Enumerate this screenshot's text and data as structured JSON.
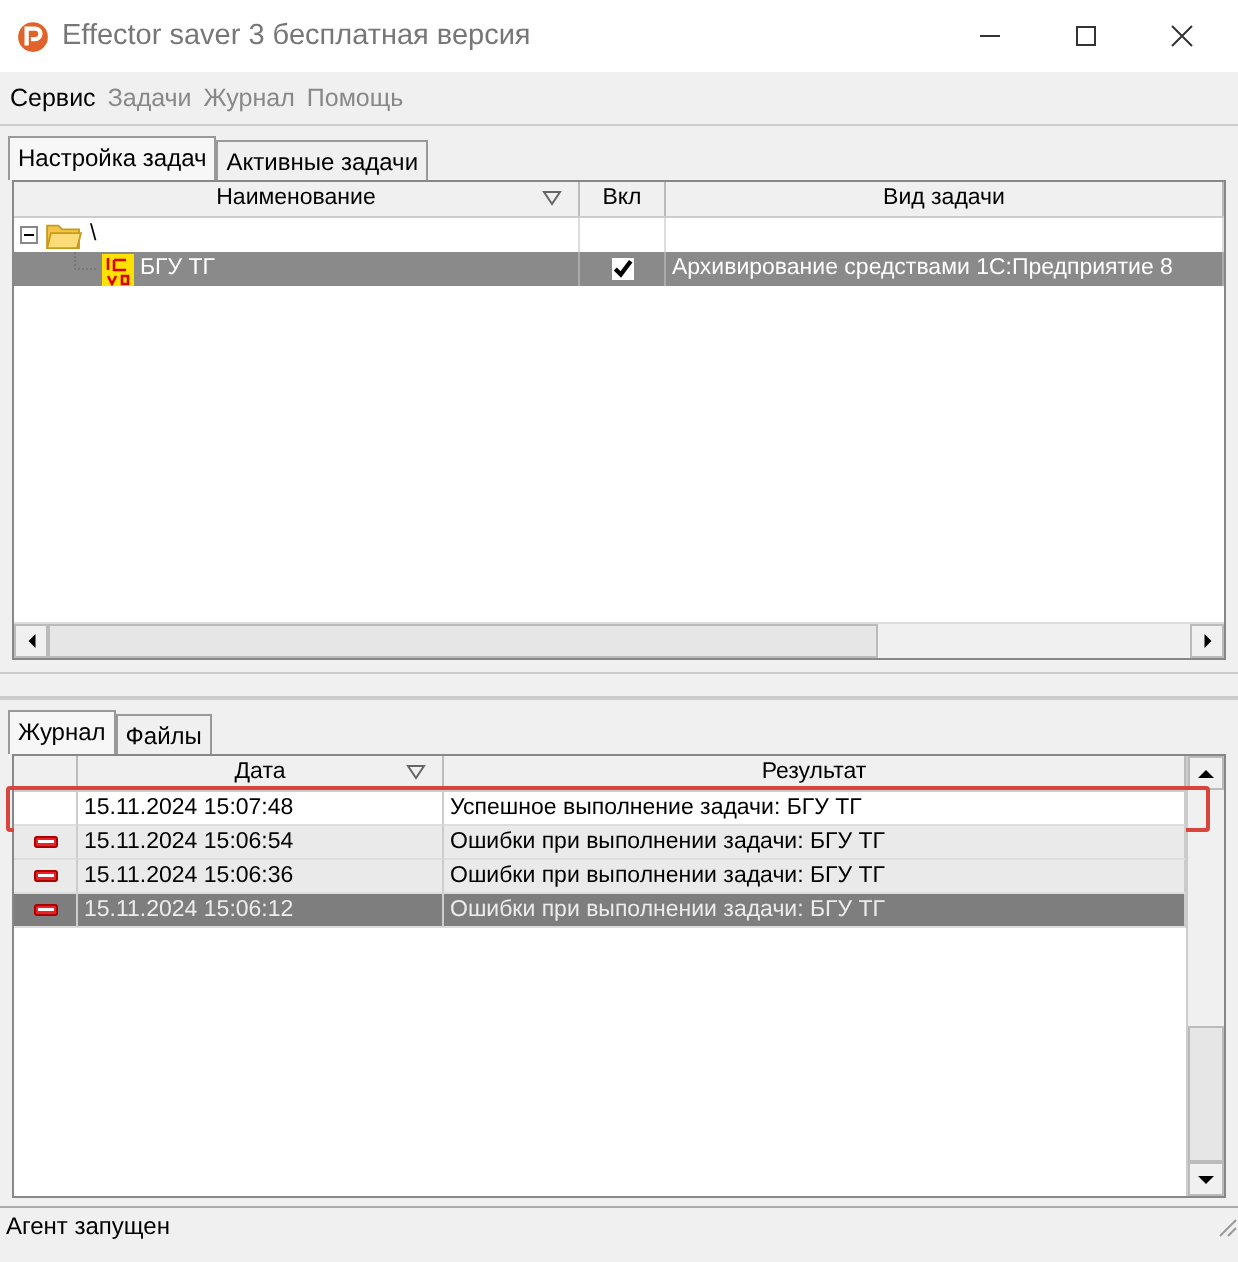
{
  "window": {
    "title": "Effector saver 3 бесплатная версия"
  },
  "menu": [
    {
      "label": "Сервис",
      "disabled": false
    },
    {
      "label": "Задачи",
      "disabled": true
    },
    {
      "label": "Журнал",
      "disabled": true
    },
    {
      "label": "Помощь",
      "disabled": true
    }
  ],
  "task_tabs": [
    {
      "label": "Настройка задач",
      "selected": true
    },
    {
      "label": "Активные задачи",
      "selected": false
    }
  ],
  "task_table": {
    "columns": [
      "Наименование",
      "Вкл",
      "Вид задачи"
    ],
    "tree": [
      {
        "name": "\\",
        "expanded": true,
        "children": [
          {
            "name": "БГУ ТГ",
            "enabled": true,
            "task_type": "Архивирование средствами 1С:Предприятие 8",
            "selected": true
          }
        ]
      }
    ]
  },
  "log_tabs": [
    {
      "label": "Журнал",
      "selected": true
    },
    {
      "label": "Файлы",
      "selected": false
    }
  ],
  "log_table": {
    "columns": [
      "Дата",
      "Результат"
    ],
    "rows": [
      {
        "kind": "success",
        "date": "15.11.2024 15:07:48",
        "result": "Успешное выполнение задачи: БГУ ТГ",
        "selected": false,
        "highlighted": true
      },
      {
        "kind": "error",
        "date": "15.11.2024 15:06:54",
        "result": "Ошибки при выполнении задачи: БГУ ТГ",
        "selected": false,
        "highlighted": false
      },
      {
        "kind": "error",
        "date": "15.11.2024 15:06:36",
        "result": "Ошибки при выполнении задачи: БГУ ТГ",
        "selected": false,
        "highlighted": false
      },
      {
        "kind": "error",
        "date": "15.11.2024 15:06:12",
        "result": "Ошибки при выполнении задачи: БГУ ТГ",
        "selected": true,
        "highlighted": false
      }
    ]
  },
  "status_bar": "Агент запущен"
}
